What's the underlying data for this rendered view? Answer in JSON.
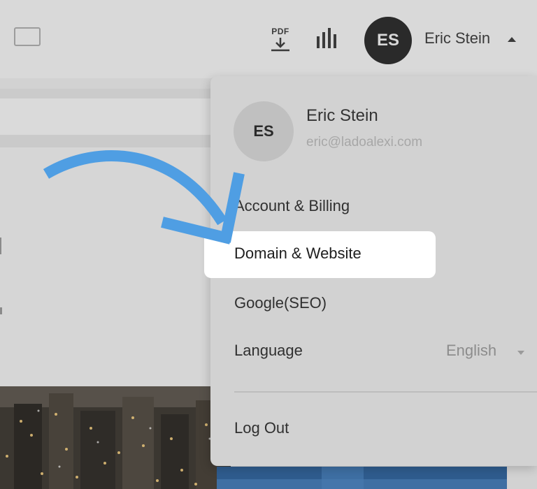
{
  "header": {
    "pdf_label": "PDF",
    "avatar_initials": "ES",
    "user_name": "Eric Stein"
  },
  "menu": {
    "avatar_initials": "ES",
    "user_name": "Eric Stein",
    "user_email": "eric@ladoalexi.com",
    "items": [
      {
        "label": "Account & Billing"
      },
      {
        "label": "Domain & Website"
      },
      {
        "label": "Google(SEO)"
      },
      {
        "label": "Language"
      },
      {
        "label": "Log Out"
      }
    ],
    "language_value": "English"
  },
  "colors": {
    "overlay": "#d2d2d2",
    "highlight": "#ffffff",
    "arrow": "#4f9ee3",
    "avatar_dark": "#2a2a2a"
  }
}
